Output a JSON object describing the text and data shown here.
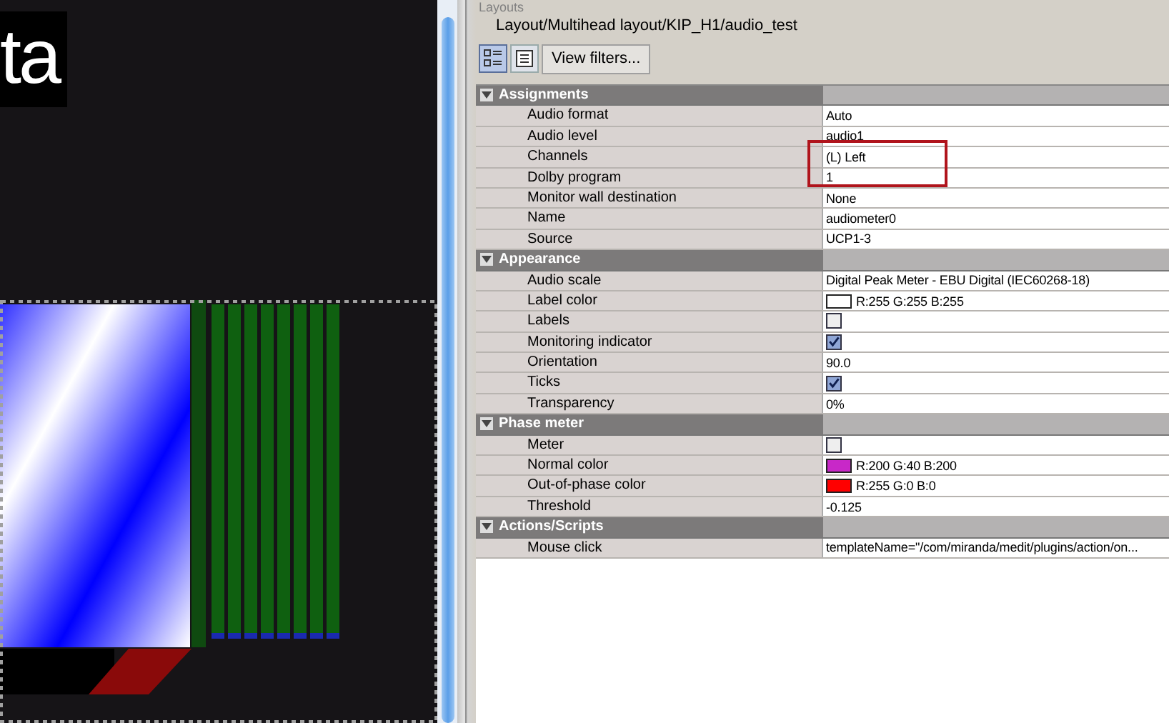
{
  "canvas": {
    "caption": "ta"
  },
  "panel": {
    "title": "Layouts",
    "path": "Layout/Multihead layout/KIP_H1/audio_test",
    "toolbar": {
      "buttons": [
        {
          "kind": "categorized",
          "selected": true
        },
        {
          "kind": "list",
          "selected": false
        }
      ],
      "filter_button": "View filters..."
    },
    "properties": [
      {
        "kind": "section",
        "label": "Assignments",
        "expanded": true
      },
      {
        "kind": "text",
        "label": "Audio format",
        "value": "Auto"
      },
      {
        "kind": "text",
        "label": "Audio level",
        "value": "audio1"
      },
      {
        "kind": "text",
        "label": "Channels",
        "value": "(L) Left"
      },
      {
        "kind": "text",
        "label": "Dolby program",
        "value": "1"
      },
      {
        "kind": "text",
        "label": "Monitor wall destination",
        "value": "None"
      },
      {
        "kind": "text",
        "label": "Name",
        "value": "audiometer0"
      },
      {
        "kind": "text",
        "label": "Source",
        "value": "UCP1-3"
      },
      {
        "kind": "section",
        "label": "Appearance",
        "expanded": true
      },
      {
        "kind": "text",
        "label": "Audio scale",
        "value": "Digital Peak Meter - EBU Digital (IEC60268-18)"
      },
      {
        "kind": "color",
        "label": "Label color",
        "value": "R:255 G:255 B:255",
        "color": "#ffffff"
      },
      {
        "kind": "checkbox",
        "label": "Labels",
        "checked": false
      },
      {
        "kind": "checkbox",
        "label": "Monitoring indicator",
        "checked": true
      },
      {
        "kind": "text",
        "label": "Orientation",
        "value": "90.0"
      },
      {
        "kind": "checkbox",
        "label": "Ticks",
        "checked": true
      },
      {
        "kind": "text",
        "label": "Transparency",
        "value": "0%"
      },
      {
        "kind": "section",
        "label": "Phase meter",
        "expanded": true
      },
      {
        "kind": "checkbox",
        "label": "Meter",
        "checked": false
      },
      {
        "kind": "color",
        "label": "Normal color",
        "value": "R:200 G:40 B:200",
        "color": "#c828c8"
      },
      {
        "kind": "color",
        "label": "Out-of-phase color",
        "value": "R:255 G:0 B:0",
        "color": "#ff0000"
      },
      {
        "kind": "text",
        "label": "Threshold",
        "value": "-0.125"
      },
      {
        "kind": "section",
        "label": "Actions/Scripts",
        "expanded": true
      },
      {
        "kind": "text",
        "label": "Mouse click",
        "value": "templateName=\"/com/miranda/medit/plugins/action/on..."
      }
    ]
  }
}
